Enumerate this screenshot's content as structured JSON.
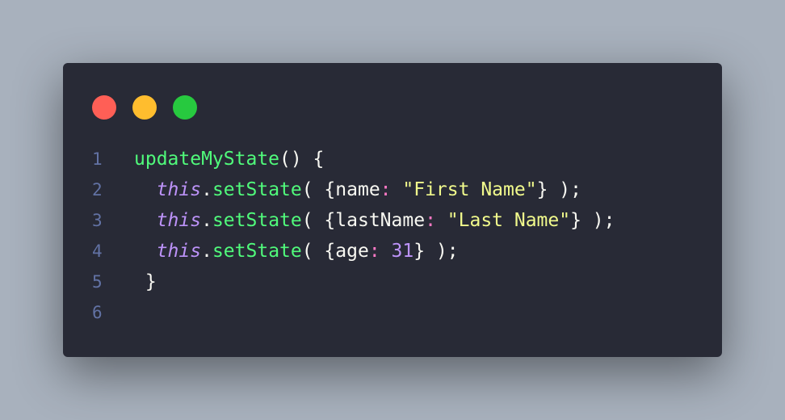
{
  "window": {
    "dots": [
      {
        "name": "close",
        "color": "#ff5f56"
      },
      {
        "name": "minimize",
        "color": "#ffbd2e"
      },
      {
        "name": "maximize",
        "color": "#27c93f"
      }
    ]
  },
  "code": {
    "lines": [
      {
        "n": "1",
        "tokens": [
          {
            "t": "updateMyState",
            "c": "fn"
          },
          {
            "t": "() {",
            "c": "punc"
          }
        ]
      },
      {
        "n": "2",
        "tokens": [
          {
            "t": "  ",
            "c": "punc"
          },
          {
            "t": "this",
            "c": "kw"
          },
          {
            "t": ".",
            "c": "punc"
          },
          {
            "t": "setState",
            "c": "fn"
          },
          {
            "t": "( {name",
            "c": "punc"
          },
          {
            "t": ":",
            "c": "colon"
          },
          {
            "t": " ",
            "c": "punc"
          },
          {
            "t": "\"First Name\"",
            "c": "str"
          },
          {
            "t": "} );",
            "c": "punc"
          }
        ]
      },
      {
        "n": "3",
        "tokens": [
          {
            "t": "  ",
            "c": "punc"
          },
          {
            "t": "this",
            "c": "kw"
          },
          {
            "t": ".",
            "c": "punc"
          },
          {
            "t": "setState",
            "c": "fn"
          },
          {
            "t": "( {lastName",
            "c": "punc"
          },
          {
            "t": ":",
            "c": "colon"
          },
          {
            "t": " ",
            "c": "punc"
          },
          {
            "t": "\"Last Name\"",
            "c": "str"
          },
          {
            "t": "} );",
            "c": "punc"
          }
        ]
      },
      {
        "n": "4",
        "tokens": [
          {
            "t": "  ",
            "c": "punc"
          },
          {
            "t": "this",
            "c": "kw"
          },
          {
            "t": ".",
            "c": "punc"
          },
          {
            "t": "setState",
            "c": "fn"
          },
          {
            "t": "( {age",
            "c": "punc"
          },
          {
            "t": ":",
            "c": "colon"
          },
          {
            "t": " ",
            "c": "punc"
          },
          {
            "t": "31",
            "c": "num"
          },
          {
            "t": "} );",
            "c": "punc"
          }
        ]
      },
      {
        "n": "5",
        "tokens": [
          {
            "t": " }",
            "c": "punc"
          }
        ]
      },
      {
        "n": "6",
        "tokens": []
      }
    ]
  }
}
